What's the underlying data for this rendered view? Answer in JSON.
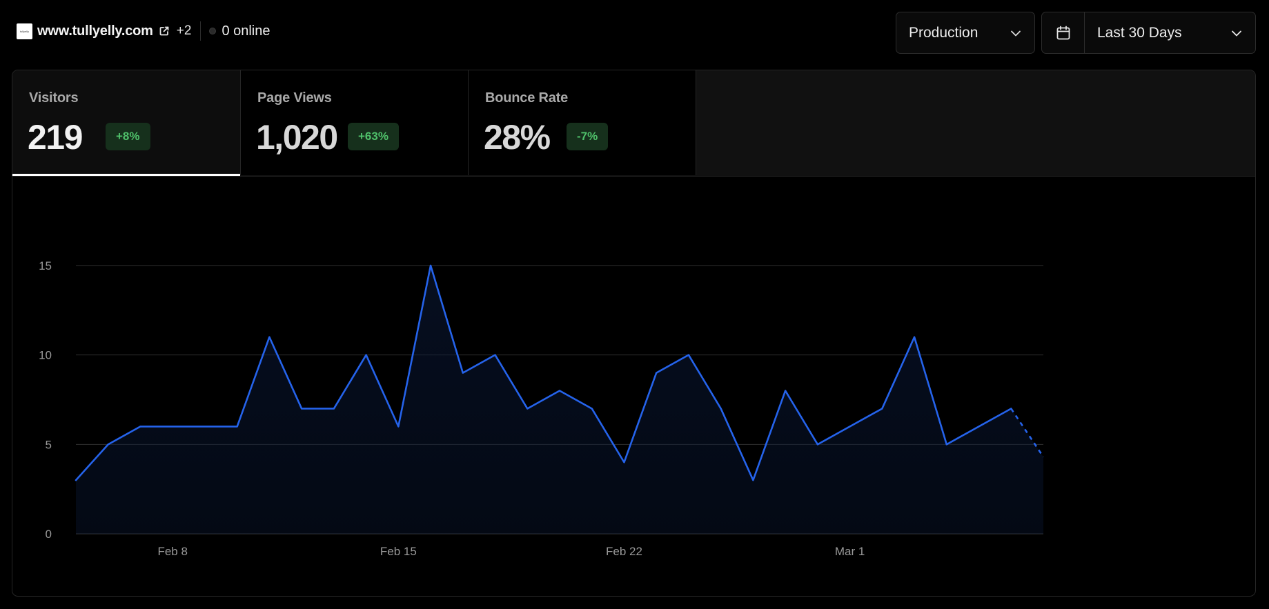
{
  "site": {
    "favicon_text": "tullyelly",
    "domain": "www.tullyelly.com",
    "extra_domains": "+2",
    "online": "0 online"
  },
  "environment": {
    "selected": "Production"
  },
  "date_range": {
    "selected": "Last 30 Days"
  },
  "icons": {
    "external": "external-link-icon",
    "calendar": "calendar-icon",
    "chevron": "chevron-down-icon",
    "status": "status-dot-icon"
  },
  "metrics": [
    {
      "label": "Visitors",
      "value": "219",
      "change": "+8%",
      "active": true
    },
    {
      "label": "Page Views",
      "value": "1,020",
      "change": "+63%",
      "active": false
    },
    {
      "label": "Bounce Rate",
      "value": "28%",
      "change": "-7%",
      "active": false
    }
  ],
  "colors": {
    "line": "#2563eb",
    "badge_bg": "#16301c",
    "badge_text": "#4fc06a",
    "grid": "#2f2f2f"
  },
  "chart_data": {
    "type": "area",
    "series": [
      {
        "values": [
          3,
          5,
          6,
          6,
          6,
          6,
          11,
          7,
          7,
          10,
          6,
          15,
          9,
          10,
          7,
          8,
          7,
          4,
          9,
          10,
          7,
          3,
          8,
          5,
          6,
          7,
          11,
          5,
          6,
          7,
          4.3
        ]
      }
    ],
    "x_ticks": [
      {
        "label": "Feb 8",
        "index": 3
      },
      {
        "label": "Feb 15",
        "index": 10
      },
      {
        "label": "Feb 22",
        "index": 17
      },
      {
        "label": "Mar 1",
        "index": 24
      }
    ],
    "y_ticks": [
      0,
      5,
      10,
      15
    ],
    "ylim": [
      0,
      15
    ],
    "partial_last_segment": true,
    "grid": true,
    "xlabel": "",
    "ylabel": ""
  }
}
